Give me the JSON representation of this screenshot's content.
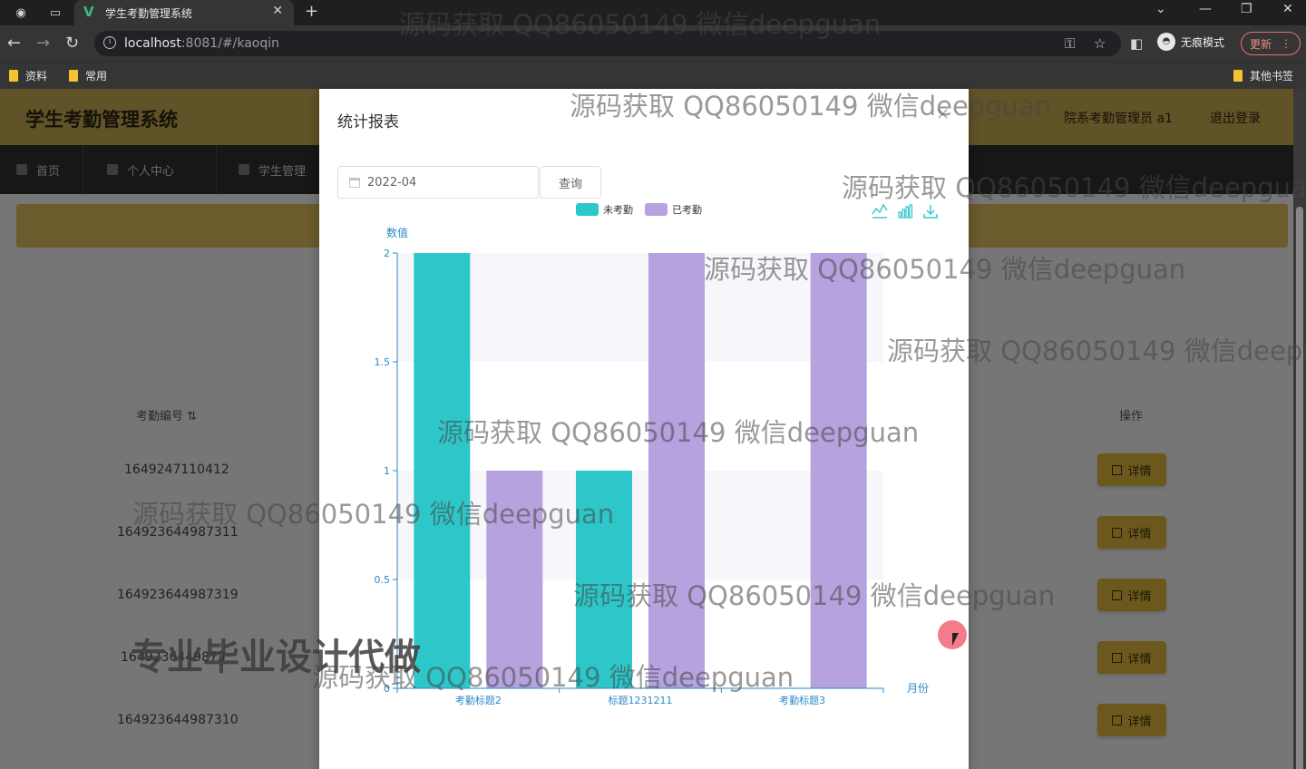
{
  "browser": {
    "tab_title": "学生考勤管理系统",
    "url_host": "localhost",
    "url_rest": ":8081/#/kaoqin",
    "incognito_label": "无痕模式",
    "update_label": "更新",
    "bookmarks": [
      "资料",
      "常用"
    ],
    "other_bookmarks": "其他书签"
  },
  "app": {
    "title": "学生考勤管理系统",
    "user": "院系考勤管理员 a1",
    "logout": "退出登录",
    "nav": [
      "首页",
      "个人中心",
      "学生管理"
    ],
    "table": {
      "col_id": "考勤编号",
      "col_action": "操作",
      "rows": [
        "1649247110412",
        "164923644987311",
        "164923644987319",
        "1649236449873",
        "164923644987310"
      ],
      "detail_label": "详情"
    }
  },
  "dialog": {
    "title": "统计报表",
    "month_value": "2022-04",
    "query_label": "查询"
  },
  "chart_data": {
    "type": "bar",
    "categories": [
      "考勤标题2",
      "标题1231211",
      "考勤标题3"
    ],
    "series": [
      {
        "name": "未考勤",
        "values": [
          2,
          1,
          0
        ],
        "color": "#2ec7c9"
      },
      {
        "name": "已考勤",
        "values": [
          1,
          2,
          2
        ],
        "color": "#b6a2de"
      }
    ],
    "ylabel": "数值",
    "xlabel": "月份",
    "ylim": [
      0,
      2
    ],
    "yticks": [
      "0",
      "0.5",
      "1",
      "1.5",
      "2"
    ],
    "legend": "top-center",
    "toolbox": [
      "line-chart-icon",
      "bar-chart-icon",
      "download-icon"
    ]
  },
  "watermark": {
    "text": "源码获取 QQ86050149 微信deepguan",
    "big_text": "专业毕业设计代做"
  }
}
